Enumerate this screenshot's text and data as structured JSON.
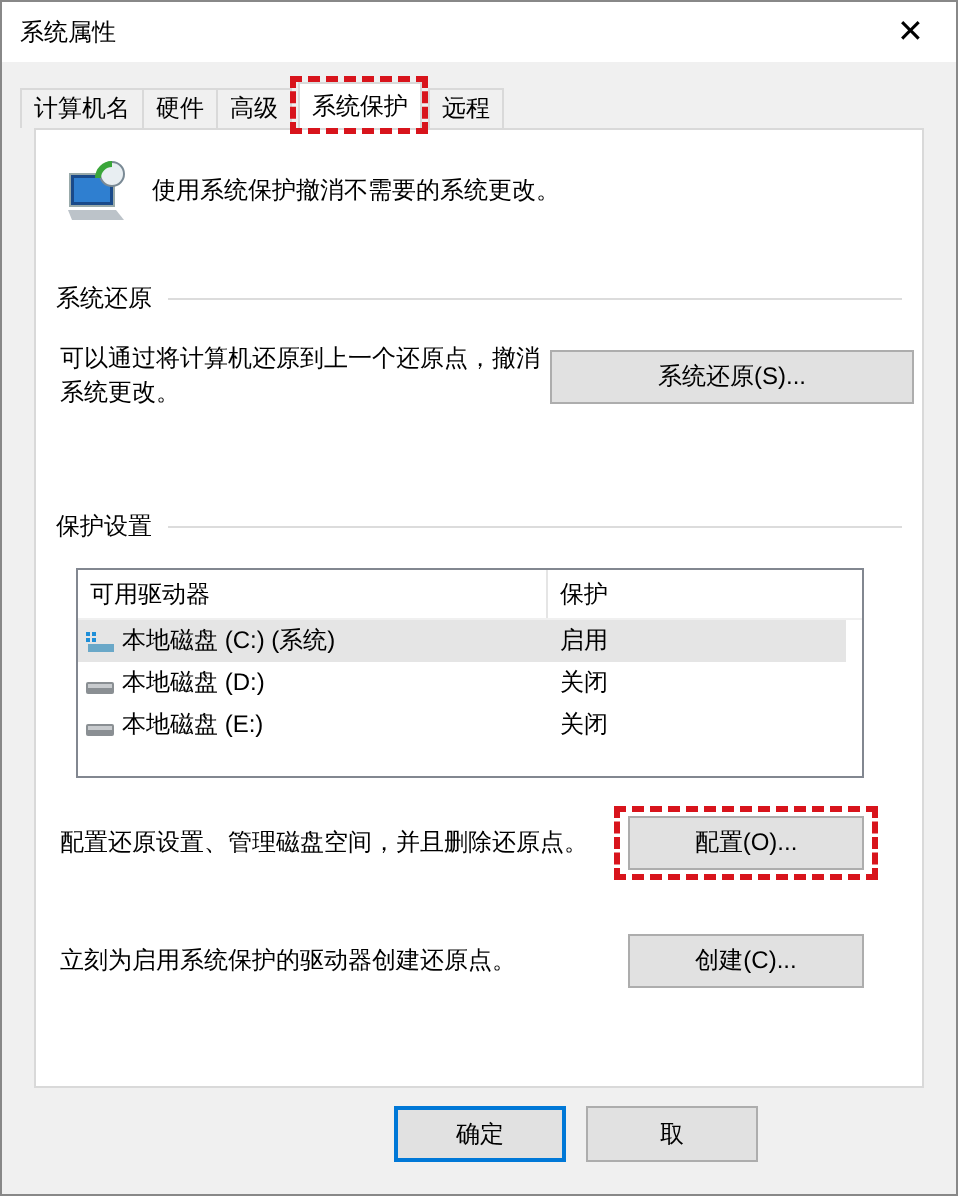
{
  "window": {
    "title": "系统属性",
    "close": "✕"
  },
  "tabs": [
    {
      "label": "计算机名",
      "selected": false,
      "highlighted": false
    },
    {
      "label": "硬件",
      "selected": false,
      "highlighted": false
    },
    {
      "label": "高级",
      "selected": false,
      "highlighted": false
    },
    {
      "label": "系统保护",
      "selected": true,
      "highlighted": true
    },
    {
      "label": "远程",
      "selected": false,
      "highlighted": false
    }
  ],
  "intro": "使用系统保护撤消不需要的系统更改。",
  "restore": {
    "heading": "系统还原",
    "text": "可以通过将计算机还原到上一个还原点，撤消系统更改。",
    "button": "系统还原(S)..."
  },
  "protection": {
    "heading": "保护设置",
    "columns": [
      "可用驱动器",
      "保护"
    ],
    "rows": [
      {
        "name": "本地磁盘 (C:) (系统)",
        "kind": "system",
        "status": "启用",
        "selected": true
      },
      {
        "name": "本地磁盘 (D:)",
        "kind": "drive",
        "status": "关闭",
        "selected": false
      },
      {
        "name": "本地磁盘 (E:)",
        "kind": "drive",
        "status": "关闭",
        "selected": false
      }
    ],
    "configure_text": "配置还原设置、管理磁盘空间，并且删除还原点。",
    "configure_button": {
      "label": "配置(O)...",
      "highlighted": true
    },
    "create_text": "立刻为启用系统保护的驱动器创建还原点。",
    "create_button": "创建(C)..."
  },
  "buttons": [
    {
      "label": "确定",
      "default": true
    },
    {
      "label": "取",
      "default": false
    }
  ]
}
